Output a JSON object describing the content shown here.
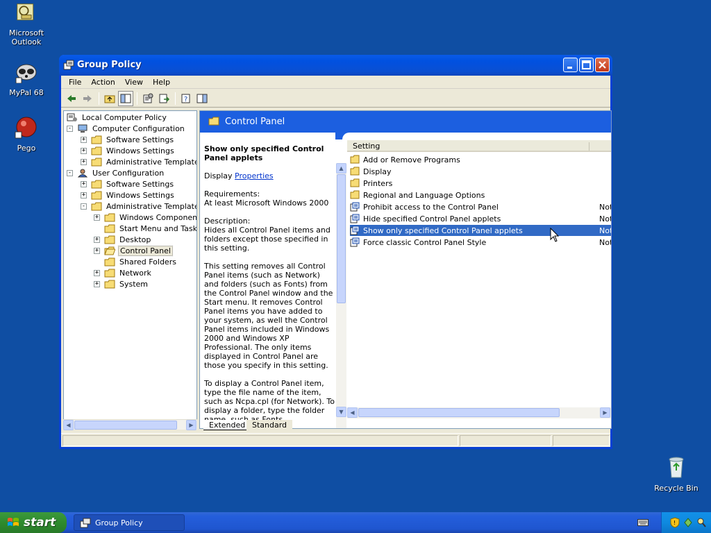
{
  "desktop": {
    "icons": [
      {
        "label_line1": "Microsoft",
        "label_line2": "Outlook",
        "icon": "outlook-icon"
      },
      {
        "label_line1": "MyPal 68",
        "label_line2": "",
        "icon": "mypal-icon"
      },
      {
        "label_line1": "Pego",
        "label_line2": "",
        "icon": "pego-icon"
      },
      {
        "label_line1": "Recycle Bin",
        "label_line2": "",
        "icon": "recycle-bin-icon"
      }
    ]
  },
  "window": {
    "title": "Group Policy",
    "menu": [
      "File",
      "Action",
      "View",
      "Help"
    ]
  },
  "tree": {
    "root": "Local Computer Policy",
    "items": [
      "Computer Configuration",
      "Software Settings",
      "Windows Settings",
      "Administrative Templates",
      "User Configuration",
      "Software Settings",
      "Windows Settings",
      "Administrative Templates",
      "Windows Components",
      "Start Menu and Taskba",
      "Desktop",
      "Control Panel",
      "Shared Folders",
      "Network",
      "System"
    ]
  },
  "panel": {
    "header_title": "Control Panel",
    "desc_title": "Show only specified Control Panel applets",
    "display_prefix": "Display",
    "display_link": "Properties",
    "requirements_label": "Requirements:",
    "requirements_text": "At least Microsoft Windows 2000",
    "description_label": "Description:",
    "description_p1": "Hides all Control Panel items and folders except those specified in this setting.",
    "description_p2": "This setting removes all Control Panel items (such as Network) and folders (such as Fonts) from the Control Panel window and the Start menu. It removes Control Panel items you have added to your system, as well the Control Panel items included in Windows 2000 and Windows XP Professional. The only items displayed in Control Panel are those you specify in this setting.",
    "description_p3": "To display a Control Panel item, type the file name of the item, such as Ncpa.cpl (for Network). To display a folder, type the folder name, such as Fonts."
  },
  "list": {
    "column_setting": "Setting",
    "rows": [
      {
        "label": "Add or Remove Programs",
        "state": "",
        "type": "folder"
      },
      {
        "label": "Display",
        "state": "",
        "type": "folder"
      },
      {
        "label": "Printers",
        "state": "",
        "type": "folder"
      },
      {
        "label": "Regional and Language Options",
        "state": "",
        "type": "folder"
      },
      {
        "label": "Prohibit access to the Control Panel",
        "state": "Not",
        "type": "policy"
      },
      {
        "label": "Hide specified Control Panel applets",
        "state": "Not",
        "type": "policy"
      },
      {
        "label": "Show only specified Control Panel applets",
        "state": "Not",
        "type": "policy",
        "selected": true
      },
      {
        "label": "Force classic Control Panel Style",
        "state": "Not",
        "type": "policy"
      }
    ]
  },
  "tabs": [
    "Extended",
    "Standard"
  ],
  "taskbar": {
    "start_label": "start",
    "task_label": "Group Policy"
  },
  "colors": {
    "desktop": "#0f4ea3",
    "titlebar": "#0151e0",
    "selection": "#316ac5",
    "window_face": "#ece9d8"
  }
}
